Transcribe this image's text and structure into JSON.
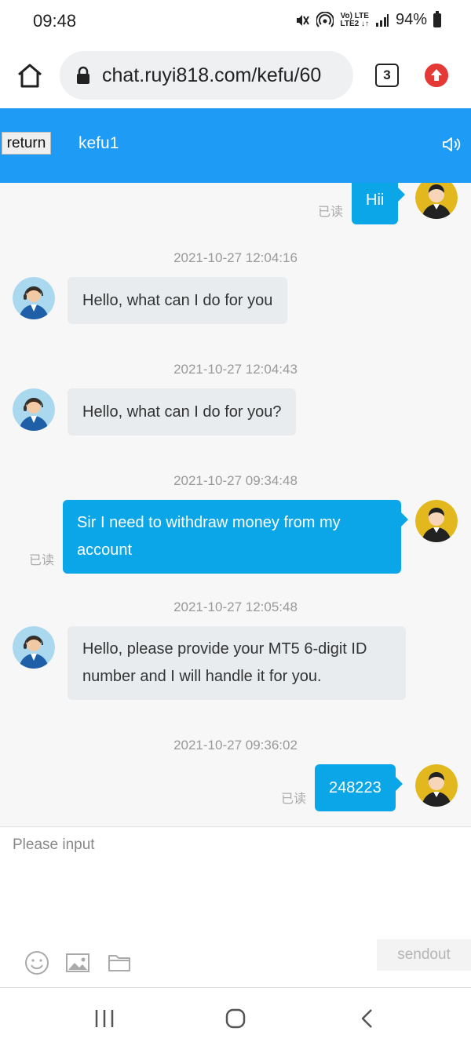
{
  "status_bar": {
    "time": "09:48",
    "network_label_top": "Vo) LTE",
    "network_label_bottom": "LTE2 ↓↑",
    "battery": "94%"
  },
  "browser": {
    "url": "chat.ruyi818.com/kefu/60",
    "tab_count": "3"
  },
  "chat_header": {
    "return_label": "return",
    "title": "kefu1",
    "accent_color": "#1e9bf5"
  },
  "messages": [
    {
      "direction": "out",
      "text": "Hii",
      "read_label": "已读"
    },
    {
      "direction": "in",
      "timestamp": "2021-10-27 12:04:16",
      "text": "Hello, what can I do for you"
    },
    {
      "direction": "in",
      "timestamp": "2021-10-27 12:04:43",
      "text": "Hello, what can I do for you?"
    },
    {
      "direction": "out",
      "timestamp": "2021-10-27 09:34:48",
      "text_line1": "Sir I need to withdraw money from my",
      "text_line2": "account",
      "read_label": "已读"
    },
    {
      "direction": "in",
      "timestamp": "2021-10-27 12:05:48",
      "text_line1": "Hello, please provide your MT5 6-digit ID",
      "text_line2": "number and I will handle it for you."
    },
    {
      "direction": "out",
      "timestamp": "2021-10-27 09:36:02",
      "text": "248223",
      "read_label": "已读"
    }
  ],
  "composer": {
    "placeholder": "Please input",
    "send_label": "sendout"
  },
  "icons": {
    "emoji": "smiley-icon",
    "image": "image-icon",
    "file": "folder-icon"
  }
}
